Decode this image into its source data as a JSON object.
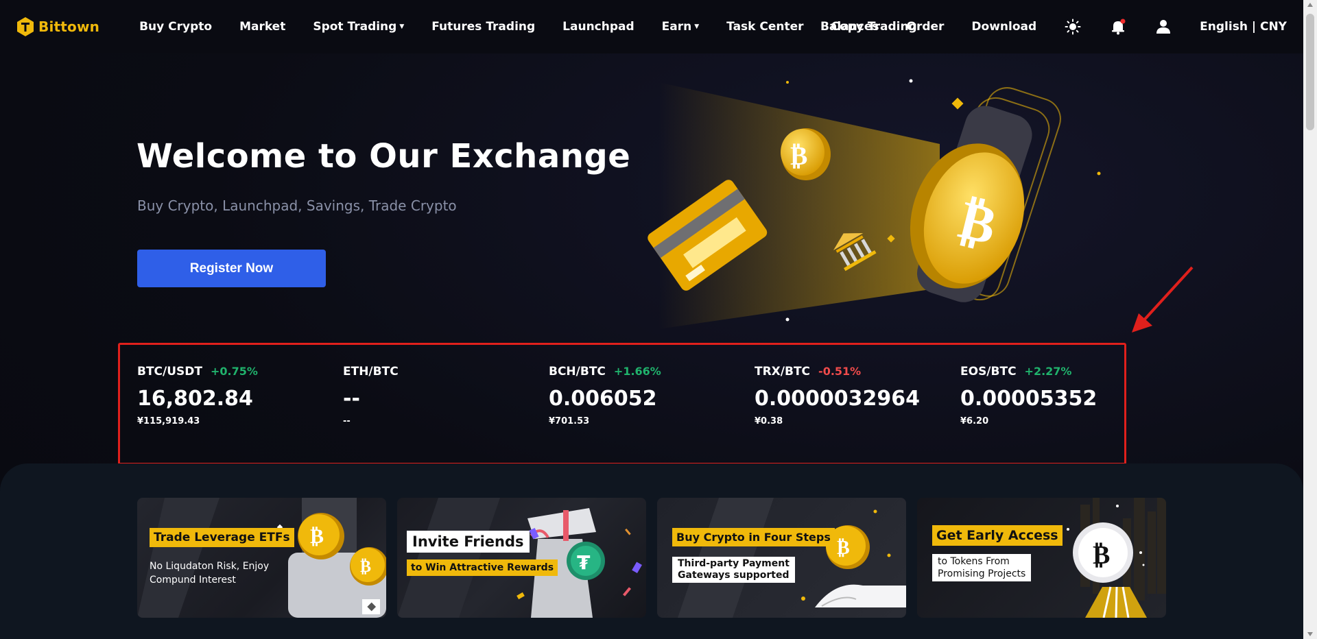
{
  "brand": {
    "name": "Bittown",
    "accent": "#f0b90b"
  },
  "nav": {
    "items": [
      {
        "label": "Buy Crypto",
        "dropdown": false
      },
      {
        "label": "Market",
        "dropdown": false
      },
      {
        "label": "Spot Trading",
        "dropdown": true
      },
      {
        "label": "Futures Trading",
        "dropdown": false
      },
      {
        "label": "Launchpad",
        "dropdown": false
      },
      {
        "label": "Earn",
        "dropdown": true
      },
      {
        "label": "Task Center",
        "dropdown": false
      },
      {
        "label": "Copy Trading",
        "dropdown": false
      }
    ],
    "right": {
      "balances": "Balances",
      "order": "Order",
      "download": "Download",
      "icons": [
        "sun-icon",
        "bell-icon",
        "user-icon"
      ],
      "language": "English | CNY"
    }
  },
  "hero": {
    "title": "Welcome to Our Exchange",
    "subtitle": "Buy Crypto, Launchpad, Savings, Trade Crypto",
    "cta": "Register Now",
    "cta_color": "#2f5fe8"
  },
  "ticker": [
    {
      "pair": "BTC/USDT",
      "change": "+0.75%",
      "direction": "up",
      "price": "16,802.84",
      "fiat": "¥115,919.43"
    },
    {
      "pair": "ETH/BTC",
      "change": "",
      "direction": "none",
      "price": "--",
      "fiat": "--"
    },
    {
      "pair": "BCH/BTC",
      "change": "+1.66%",
      "direction": "up",
      "price": "0.006052",
      "fiat": "¥701.53"
    },
    {
      "pair": "TRX/BTC",
      "change": "-0.51%",
      "direction": "down",
      "price": "0.0000032964",
      "fiat": "¥0.38"
    },
    {
      "pair": "EOS/BTC",
      "change": "+2.27%",
      "direction": "up",
      "price": "0.00005352",
      "fiat": "¥6.20"
    }
  ],
  "colors": {
    "up": "#20b26c",
    "down": "#ef4b4b",
    "annotation": "#e0201c"
  },
  "banners": [
    {
      "title": "Trade Leverage ETFs",
      "desc_line1": "No Liqudaton Risk, Enjoy",
      "desc_line2": "Compund Interest"
    },
    {
      "title": "Invite Friends",
      "subtitle": "to Win Attractive Rewards"
    },
    {
      "title": "Buy Crypto in Four Steps",
      "subtitle_line1": "Third-party Payment",
      "subtitle_line2": "Gateways supported"
    },
    {
      "title": "Get Early Access",
      "subtitle_line1": "to Tokens From",
      "subtitle_line2": "Promising Projects"
    }
  ]
}
